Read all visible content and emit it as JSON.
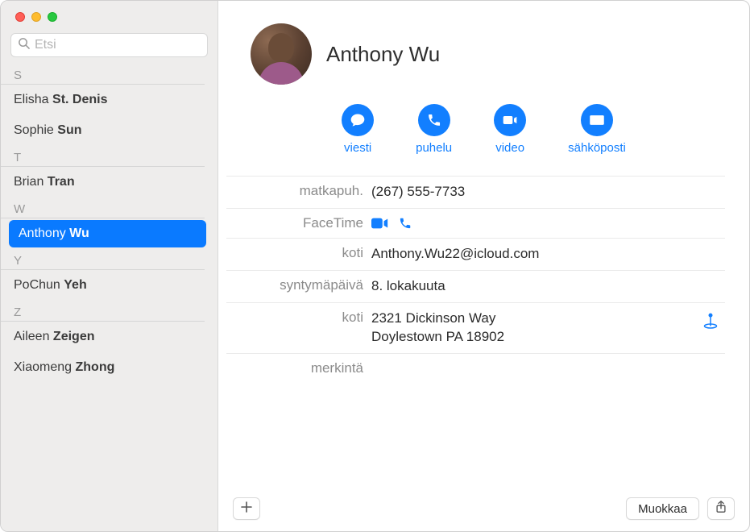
{
  "search": {
    "placeholder": "Etsi"
  },
  "sections": [
    {
      "letter": "S",
      "items": [
        {
          "first": "Elisha",
          "last": "St. Denis"
        },
        {
          "first": "Sophie",
          "last": "Sun"
        }
      ]
    },
    {
      "letter": "T",
      "items": [
        {
          "first": "Brian",
          "last": "Tran"
        }
      ]
    },
    {
      "letter": "W",
      "items": [
        {
          "first": "Anthony",
          "last": "Wu",
          "selected": true
        }
      ]
    },
    {
      "letter": "Y",
      "items": [
        {
          "first": "PoChun",
          "last": "Yeh"
        }
      ]
    },
    {
      "letter": "Z",
      "items": [
        {
          "first": "Aileen",
          "last": "Zeigen"
        },
        {
          "first": "Xiaomeng",
          "last": "Zhong"
        }
      ]
    }
  ],
  "detail": {
    "name": "Anthony Wu",
    "actions": {
      "message": "viesti",
      "call": "puhelu",
      "video": "video",
      "mail": "sähköposti"
    },
    "fields": {
      "mobile_label": "matkapuh.",
      "mobile_value": "(267) 555-7733",
      "facetime_label": "FaceTime",
      "home_email_label": "koti",
      "home_email_value": "Anthony.Wu22@icloud.com",
      "birthday_label": "syntymäpäivä",
      "birthday_value": "8. lokakuuta",
      "home_addr_label": "koti",
      "home_addr_line1": "2321 Dickinson Way",
      "home_addr_line2": "Doylestown PA 18902",
      "note_label": "merkintä"
    }
  },
  "buttons": {
    "edit": "Muokkaa"
  },
  "colors": {
    "accent": "#127fff"
  }
}
